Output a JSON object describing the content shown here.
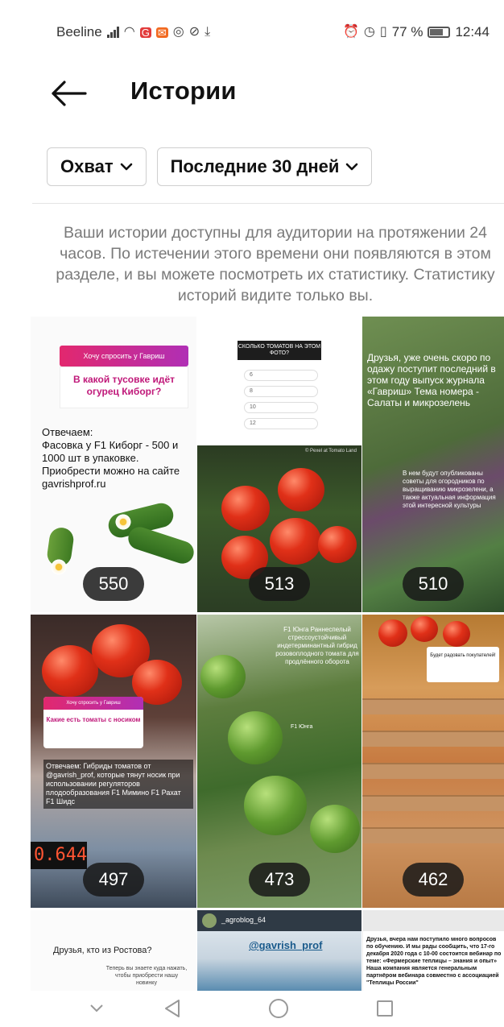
{
  "status_bar": {
    "carrier": "Beeline",
    "battery_percent": "77 %",
    "time": "12:44"
  },
  "header": {
    "title": "Истории",
    "back_icon": "arrow-left-icon"
  },
  "filters": {
    "metric": "Охват",
    "period": "Последние 30 дней"
  },
  "info_text": "Ваши истории доступны для аудитории на протяжении 24 часов. По истечении этого времени они появляются в этом разделе, и вы можете посмотреть их статистику. Статистику историй видите только вы.",
  "stories": [
    {
      "reach": "550",
      "sticker": "Хочу спросить у Гавриш",
      "question": "В какой тусовке идёт огурец Киборг?",
      "text": "Отвечаем:\nФасовка у F1 Киборг - 500 и 1000 шт в упаковке. Приобрести можно на сайте gavrishprof.ru"
    },
    {
      "reach": "513",
      "poll_title": "СКОЛЬКО ТОМАТОВ НА ЭТОМ ФОТО?",
      "poll_options": [
        "6",
        "8",
        "10",
        "12"
      ],
      "photo_credit": "© Pexel at Tomato Land"
    },
    {
      "reach": "510",
      "text": "Друзья, уже очень скоро по одажу поступит последний в этом году выпуск журнала «Гавриш» Тема номера - Салаты и микрозелень",
      "text2": "В нем будут опубликованы советы для огородников по выращиванию микрозелени, а также актуальная информация этой интересной культуры"
    },
    {
      "reach": "497",
      "sticker": "Хочу спросить у Гавриш",
      "question": "Какие есть томаты с носиком",
      "text": "Отвечаем: Гибриды томатов от @gavrish_prof, которые тянут носик при использовании регуляторов плодообразования F1 Мимино F1 Рахат F1 Шидс",
      "scale_reading": "0.644"
    },
    {
      "reach": "473",
      "caption": "F1 Юнга Раннеспелый стрессоустойчивый индетерминантный гибрид розовоплодного томата для продлённого оборота",
      "label": "F1 Юнга"
    },
    {
      "reach": "462",
      "card_text": "Будет радовать покупателей!"
    },
    {
      "question": "Друзья, кто из Ростова?",
      "subtext": "Теперь вы знаете куда нажать, чтобы приобрести нашу новинку"
    },
    {
      "blog_name": "_agroblog_64",
      "handle": "@gavrish_prof"
    },
    {
      "text": "Друзья, вчера нам поступило много вопросов по обучению. И мы рады сообщить, что 17-го декабря 2020 года с 10-00 состоится вебинар по теме: «Фермерские теплицы – знания и опыт» Наша компания является генеральным партнёром вебинара совместно с ассоциацией \"Теплицы России\""
    }
  ],
  "nav_bar": {
    "back": "nav-back-icon",
    "home": "nav-home-icon",
    "recents": "nav-recents-icon"
  },
  "colors": {
    "badge_bg": "#191919",
    "text_secondary": "#7a7a7a",
    "border": "#cfcfcf"
  }
}
